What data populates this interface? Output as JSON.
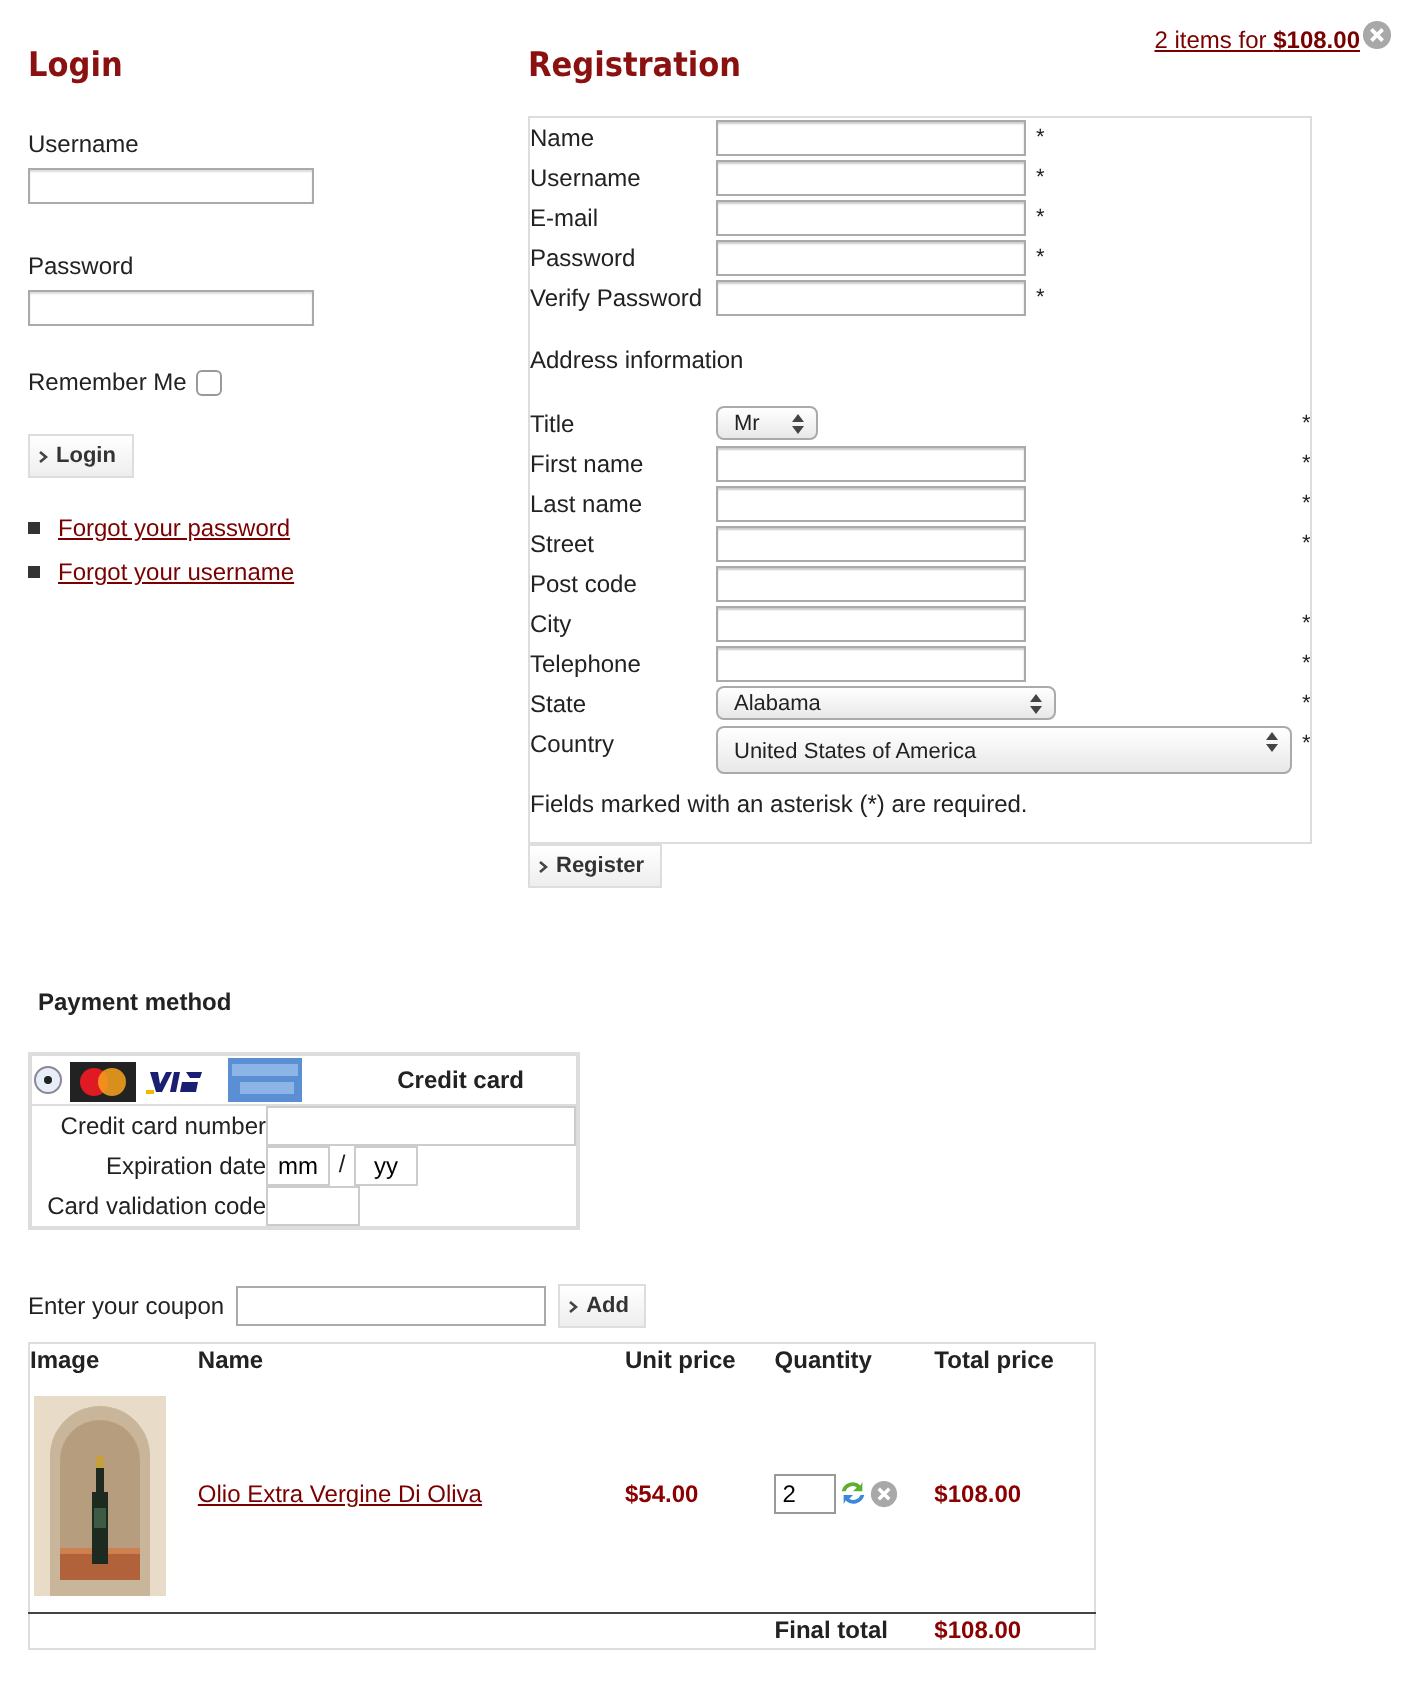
{
  "cart_summary": {
    "link": "2 items for **$108.00**"
  },
  "login": {
    "title": "Login",
    "fields": [
      {
        "label": "Username"
      },
      {
        "label": "Password"
      }
    ],
    "remember": {
      "label": "Remember Me",
      "checked": false
    },
    "button": "Login",
    "links": [
      "Forgot your password",
      "Forgot your username"
    ]
  },
  "registration": {
    "title": "Registration",
    "account_fields": [
      {
        "label": "Name",
        "mark": "*"
      },
      {
        "label": "Username",
        "mark": "*"
      },
      {
        "label": "E-mail",
        "mark": "*"
      },
      {
        "label": "Password",
        "mark": "*"
      },
      {
        "label": "Verify Password",
        "mark": "*"
      }
    ],
    "section_title": "Address information",
    "address_fields": [
      {
        "label": "Title",
        "kind": "select-small",
        "value": "Mr",
        "mark": "*"
      },
      {
        "label": "First name",
        "kind": "text",
        "mark": "*"
      },
      {
        "label": "Last name",
        "kind": "text",
        "mark": "*"
      },
      {
        "label": "Street",
        "kind": "text",
        "mark": "*"
      },
      {
        "label": "Post code",
        "kind": "text"
      },
      {
        "label": "City",
        "kind": "text",
        "mark": "*"
      },
      {
        "label": "Telephone",
        "kind": "text",
        "mark": "*"
      },
      {
        "label": "State",
        "kind": "select-medium",
        "value": "Alabama",
        "mark": "*"
      },
      {
        "label": "Country",
        "kind": "select-large",
        "value": "United States of America",
        "mark": "*"
      }
    ],
    "note": "Fields marked with an asterisk (*) are required.",
    "button": "Register"
  },
  "payment": {
    "title": "Payment method",
    "methods": [
      {
        "label": "Credit card",
        "selected": true
      }
    ],
    "fields": [
      {
        "label": "Credit card number",
        "kind": "text"
      },
      {
        "label": "Expiration date",
        "kind": "date",
        "month": "mm",
        "separator": "/",
        "year": "yy"
      },
      {
        "label": "Card validation code",
        "kind": "short"
      }
    ]
  },
  "coupon": {
    "label": "Enter your coupon",
    "button": "Add"
  },
  "cart": {
    "columns": [
      "Image",
      "Name",
      "Unit price",
      "Quantity",
      "Total price"
    ],
    "rows": [
      {
        "name": "Olio Extra Vergine Di Oliva",
        "unit_price": "$54.00",
        "quantity": "2",
        "total_price": "$108.00"
      }
    ],
    "final_label": "Final total",
    "final_total": "$108.00"
  }
}
